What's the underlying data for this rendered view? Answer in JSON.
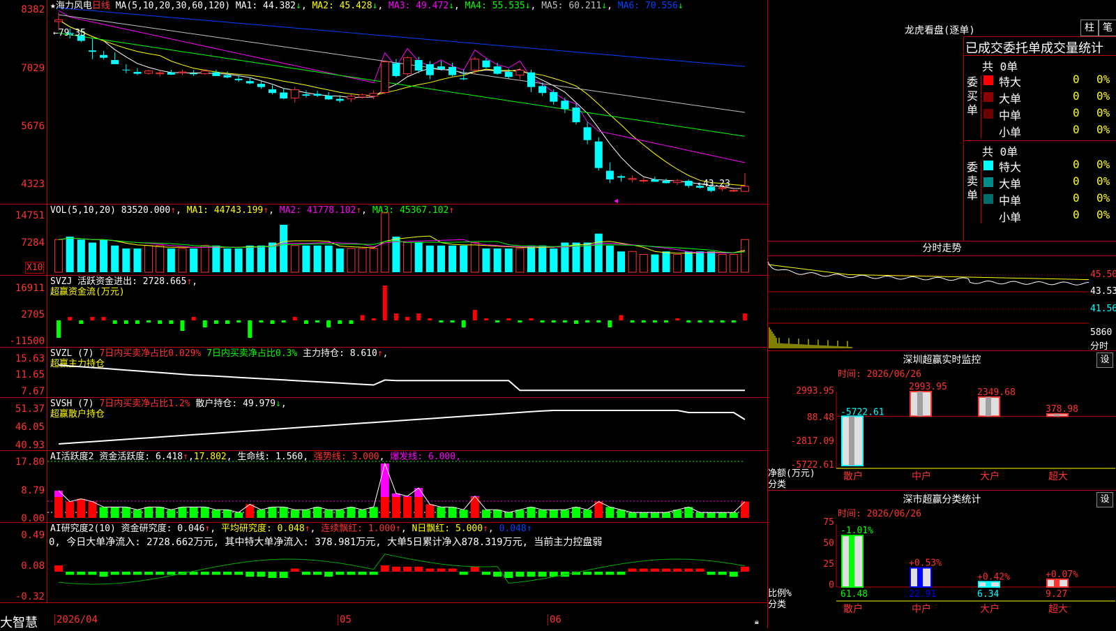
{
  "main": {
    "star": "★",
    "stock_name": "海力风电",
    "period": "日线",
    "ma_title": "MA(5,10,20,30,60,120)",
    "ma": [
      {
        "label": "MA1:",
        "value": "44.382",
        "arrow": "↓",
        "color": "#ffffff"
      },
      {
        "label": "MA2:",
        "value": "45.428",
        "arrow": "↓",
        "color": "#ffff00"
      },
      {
        "label": "MA3:",
        "value": "49.472",
        "arrow": "↓",
        "color": "#ff00ff"
      },
      {
        "label": "MA4:",
        "value": "55.535",
        "arrow": "↓",
        "color": "#00ff00"
      },
      {
        "label": "MA5:",
        "value": "60.211",
        "arrow": "↓",
        "color": "#c0c0c0"
      },
      {
        "label": "MA6:",
        "value": "70.556",
        "arrow": "↓",
        "color": "#0040ff"
      }
    ],
    "y_labels": [
      "8382",
      "7029",
      "5676",
      "4323"
    ],
    "high_mark": "←79.35",
    "low_mark": "←43.23"
  },
  "vol": {
    "title": "VOL(5,10,20)",
    "value": "83520.000",
    "ma": [
      {
        "label": "MA1:",
        "value": "44743.199",
        "arrow": "↑",
        "color": "#ffff00"
      },
      {
        "label": "MA2:",
        "value": "41778.102",
        "arrow": "↑",
        "color": "#ff00ff"
      },
      {
        "label": "MA3:",
        "value": "45367.102",
        "arrow": "↑",
        "color": "#00ff00"
      }
    ],
    "y_labels": [
      "14751",
      "7284"
    ],
    "unit": "X10"
  },
  "svzj": {
    "title": "SVZJ",
    "label": "活跃资金进出:",
    "value": "2728.665",
    "arrow": "↑",
    "subtitle": "超赢资金流(万元)",
    "y_labels": [
      "16911",
      "2705",
      "-11500"
    ]
  },
  "svzl": {
    "title": "SVZL (7)",
    "t1": "7日内买卖净占比0.029%",
    "t2": "7日内买卖净占比0.3%",
    "t3": "主力持仓: 8.610",
    "arrow": "↑",
    "subtitle": "超赢主力持仓",
    "y_labels": [
      "15.63",
      "11.65",
      "7.67"
    ]
  },
  "svsh": {
    "title": "SVSH (7)",
    "t1": "7日内买卖净占比1.2%",
    "t2": "散户持仓: 49.979",
    "arrow": "↓",
    "subtitle": "超赢散户持仓",
    "y_labels": [
      "51.37",
      "46.05",
      "40.93"
    ]
  },
  "ai1": {
    "title": "AI活跃度2",
    "t1": "资金活跃度: 6.418",
    "t2": "17.802",
    "t3": "生命线: 1.560",
    "t4": "强势线: 3.000",
    "t5": "爆发线: 6.000,",
    "y_labels": [
      "17.80",
      "8.79",
      "0.00"
    ]
  },
  "ai2": {
    "title": "AI研究度2(10)",
    "t1": "资金研究度: 0.046",
    "t2": "平均研究度: 0.048",
    "t3": "连续飘红: 1.000",
    "t4": "N日飘红: 5.000",
    "t5": "0.048",
    "summary": "0, 今日大单净流入: 2728.662万元, 其中特大单净流入: 378.981万元, 大单5日累计净入878.319万元, 当前主力控盘弱",
    "y_labels": [
      "0.49",
      "0.08",
      "-0.32"
    ]
  },
  "footer": {
    "brand": "大智慧",
    "dates": [
      "2026/04",
      "05",
      "06"
    ]
  },
  "dragon": {
    "title": "龙虎看盘(逐单)",
    "tab1": "柱",
    "tab2": "笔",
    "subtitle": "已成交委托单成交量统计",
    "buy_label": "委买单",
    "sell_label": "委卖单",
    "buy_total": "共 0单",
    "sell_total": "共 0单",
    "buy_rows": [
      {
        "name": "特大",
        "count": "0",
        "pct": "0%",
        "color": "#ff0000"
      },
      {
        "name": "大单",
        "count": "0",
        "pct": "0%",
        "color": "#8b0000"
      },
      {
        "name": "中单",
        "count": "0",
        "pct": "0%",
        "color": "#6b0000"
      },
      {
        "name": "小单",
        "count": "0",
        "pct": "0%",
        "color": ""
      }
    ],
    "sell_rows": [
      {
        "name": "特大",
        "count": "0",
        "pct": "0%",
        "color": "#00ffff"
      },
      {
        "name": "大单",
        "count": "0",
        "pct": "0%",
        "color": "#008b8b"
      },
      {
        "name": "中单",
        "count": "0",
        "pct": "0%",
        "color": "#006b6b"
      },
      {
        "name": "小单",
        "count": "0",
        "pct": "0%",
        "color": ""
      }
    ]
  },
  "intraday": {
    "title": "分时走势",
    "y_labels": [
      "45.50",
      "43.53",
      "41.56"
    ],
    "vol_label": "5860",
    "vol_unit": "分时"
  },
  "monitor": {
    "title": "深圳超赢实时监控",
    "time": "时间: 2026/06/26",
    "set": "设",
    "y_labels": [
      "2993.95",
      "88.48",
      "-2817.09",
      "-5722.61"
    ],
    "axis_unit": "净额(万元)",
    "axis_cat": "分类",
    "bars": [
      {
        "cat": "散户",
        "value": -5722.61,
        "label": "-5722.61"
      },
      {
        "cat": "中户",
        "value": 2993.95,
        "label": "2993.95"
      },
      {
        "cat": "大户",
        "value": 2349.68,
        "label": "2349.68"
      },
      {
        "cat": "超大",
        "value": 378.98,
        "label": "378.98"
      }
    ]
  },
  "classify": {
    "title": "深市超赢分类统计",
    "time": "时间: 2026/06/26",
    "set": "设",
    "y_labels": [
      "75",
      "50",
      "25",
      "0"
    ],
    "axis_unit": "比例%",
    "axis_cat": "分类",
    "bars": [
      {
        "cat": "散户",
        "value": 61.48,
        "label": "61.48",
        "change": "-1.01%"
      },
      {
        "cat": "中户",
        "value": 22.91,
        "label": "22.91",
        "change": "+0.53%"
      },
      {
        "cat": "大户",
        "value": 6.34,
        "label": "6.34",
        "change": "+0.42%"
      },
      {
        "cat": "超大",
        "value": 9.27,
        "label": "9.27",
        "change": "+0.07%"
      }
    ]
  },
  "chart_data": {
    "type": "candlestick",
    "title": "海力风电 日线",
    "ylim": [
      43.23,
      83.82
    ],
    "note": "daily OHLC approx (price units = axis/100)",
    "ohlc": [
      [
        80.5,
        82.5,
        78.6,
        80.9
      ],
      [
        78.0,
        79.0,
        76.8,
        77.8
      ],
      [
        77.5,
        78.8,
        76.0,
        76.3
      ],
      [
        74.2,
        76.8,
        72.3,
        73.9
      ],
      [
        73.2,
        74.1,
        72.2,
        72.6
      ],
      [
        72.1,
        73.8,
        71.5,
        71.2
      ],
      [
        70.0,
        71.2,
        69.2,
        69.9
      ],
      [
        69.5,
        70.3,
        68.8,
        69.1
      ],
      [
        69.2,
        70.0,
        68.9,
        69.7
      ],
      [
        69.1,
        69.8,
        68.5,
        69.3
      ],
      [
        69.4,
        70.0,
        68.8,
        68.9
      ],
      [
        69.3,
        70.0,
        68.8,
        69.5
      ],
      [
        69.2,
        69.9,
        68.6,
        69.0
      ],
      [
        69.1,
        70.1,
        68.9,
        69.7
      ],
      [
        69.4,
        70.0,
        68.6,
        68.6
      ],
      [
        68.8,
        69.6,
        68.1,
        68.3
      ],
      [
        68.0,
        68.8,
        67.3,
        67.7
      ],
      [
        67.5,
        68.3,
        66.8,
        67.0
      ],
      [
        66.9,
        67.5,
        65.8,
        66.2
      ],
      [
        65.7,
        66.6,
        64.6,
        64.9
      ],
      [
        65.0,
        66.0,
        63.5,
        63.7
      ],
      [
        63.8,
        66.2,
        62.8,
        65.6
      ],
      [
        64.6,
        65.5,
        63.9,
        64.3
      ],
      [
        64.7,
        65.4,
        64.0,
        64.3
      ],
      [
        64.3,
        65.1,
        63.4,
        63.5
      ],
      [
        63.6,
        64.4,
        62.8,
        63.2
      ],
      [
        63.6,
        64.6,
        62.9,
        64.2
      ],
      [
        64.0,
        64.8,
        63.7,
        64.5
      ],
      [
        64.2,
        65.5,
        63.5,
        64.8
      ],
      [
        65.0,
        72.0,
        64.6,
        71.7
      ],
      [
        71.4,
        72.3,
        68.3,
        68.6
      ],
      [
        69.1,
        72.9,
        68.6,
        72.6
      ],
      [
        72.1,
        72.8,
        69.2,
        69.8
      ],
      [
        71.2,
        71.9,
        67.9,
        68.8
      ],
      [
        70.7,
        71.9,
        69.8,
        70.1
      ],
      [
        70.6,
        71.5,
        68.5,
        68.8
      ],
      [
        68.1,
        70.1,
        67.7,
        67.9
      ],
      [
        69.9,
        72.8,
        69.1,
        72.3
      ],
      [
        72.0,
        72.5,
        70.3,
        70.5
      ],
      [
        70.7,
        71.5,
        68.9,
        69.1
      ],
      [
        69.5,
        70.2,
        68.0,
        68.4
      ],
      [
        68.8,
        70.4,
        67.9,
        69.9
      ],
      [
        69.4,
        70.0,
        65.1,
        66.2
      ],
      [
        66.4,
        67.2,
        64.3,
        64.9
      ],
      [
        65.1,
        65.7,
        62.3,
        63.0
      ],
      [
        63.2,
        63.9,
        60.5,
        61.4
      ],
      [
        61.7,
        62.6,
        58.0,
        58.5
      ],
      [
        57.4,
        58.6,
        53.7,
        54.6
      ],
      [
        54.3,
        55.2,
        47.9,
        48.5
      ],
      [
        47.9,
        49.7,
        45.2,
        46.0
      ],
      [
        46.7,
        47.0,
        45.5,
        46.4
      ],
      [
        46.0,
        46.9,
        45.4,
        46.2
      ],
      [
        45.8,
        46.4,
        45.3,
        45.8
      ],
      [
        46.0,
        46.6,
        45.5,
        45.5
      ],
      [
        45.7,
        46.2,
        45.1,
        45.2
      ],
      [
        45.3,
        46.1,
        44.8,
        45.7
      ],
      [
        45.7,
        46.0,
        44.2,
        44.6
      ],
      [
        44.6,
        45.3,
        44.0,
        44.2
      ],
      [
        44.4,
        45.1,
        43.2,
        43.5
      ],
      [
        44.0,
        44.6,
        43.4,
        44.2
      ],
      [
        43.5,
        43.8,
        43.23,
        43.6
      ],
      [
        43.4,
        47.4,
        43.3,
        44.5
      ]
    ]
  }
}
